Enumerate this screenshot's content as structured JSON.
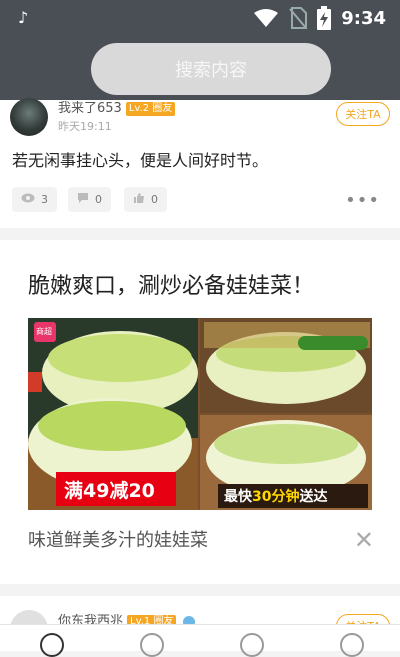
{
  "status_bar": {
    "time": "9:34",
    "icons": [
      "tiktok-icon",
      "wifi-icon",
      "no-sim-icon",
      "battery-charging-icon"
    ]
  },
  "search": {
    "placeholder": "搜索内容"
  },
  "post1": {
    "username": "我来了653",
    "level": "Lv.2 圈友",
    "time": "昨天19:11",
    "follow": "关注TA",
    "text": "若无闲事挂心头，便是人间好时节。",
    "stats": {
      "views": "3",
      "comments": "0",
      "likes": "0"
    }
  },
  "ad": {
    "title": "脆嫩爽口，涮炒必备娃娃菜！",
    "subtitle": "味道鲜美多汁的娃娃菜",
    "image_texts": {
      "promo": "满49减20",
      "delivery_prefix": "最快",
      "delivery_highlight": "30分钟",
      "delivery_suffix": "送达",
      "logo": "商超"
    }
  },
  "post2": {
    "username": "你东我西兆",
    "level": "Lv.1 圈友",
    "follow": "关注TA"
  },
  "colors": {
    "accent": "#f5a623",
    "statusbar": "#4a4f55",
    "promo_red": "#e60012",
    "highlight_yellow": "#ffd800"
  }
}
